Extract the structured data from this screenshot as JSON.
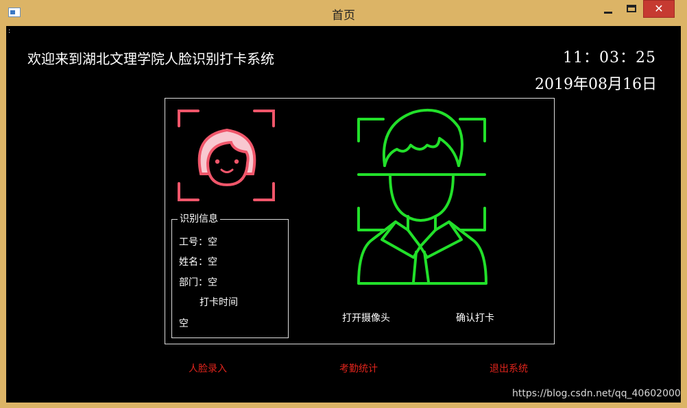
{
  "window": {
    "title": "首页",
    "close_symbol": "✕"
  },
  "header": {
    "welcome": "欢迎来到湖北文理学院人脸识别打卡系统",
    "time": "11：03：25",
    "date": "2019年08月16日"
  },
  "info": {
    "group_title": "识别信息",
    "employee_id": "工号：空",
    "name": "姓名：空",
    "department": "部门：空",
    "punch_time_label": "打卡时间",
    "punch_time_value": "空"
  },
  "actions": {
    "open_camera": "打开摄像头",
    "confirm_punch": "确认打卡"
  },
  "nav": {
    "face_enroll": "人脸录入",
    "attendance_stats": "考勤统计",
    "exit_system": "退出系统"
  },
  "watermark": "https://blog.csdn.net/qq_40602000",
  "colors": {
    "accent_red": "#e0241c",
    "face_pink": "#f0566a",
    "face_green": "#22e02a",
    "background": "#000000",
    "frame": "#dcb466"
  },
  "icons": {
    "girl": "female-face-scan-icon",
    "man": "male-face-scan-icon"
  }
}
